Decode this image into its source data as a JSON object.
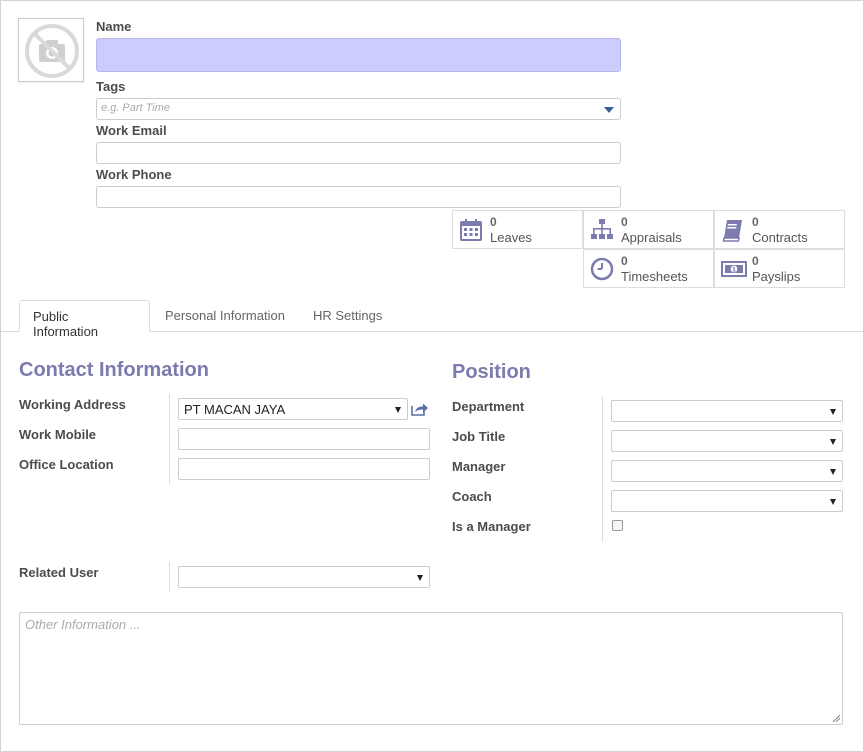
{
  "header": {
    "avatar_icon": "camera-off-icon",
    "name_label": "Name",
    "name_value": "",
    "tags_label": "Tags",
    "tags_placeholder": "e.g. Part Time",
    "email_label": "Work Email",
    "email_value": "",
    "phone_label": "Work Phone",
    "phone_value": ""
  },
  "smart_buttons": [
    {
      "count": "0",
      "label": "Leaves",
      "icon": "calendar-icon"
    },
    {
      "count": "0",
      "label": "Appraisals",
      "icon": "sitemap-icon"
    },
    {
      "count": "0",
      "label": "Contracts",
      "icon": "book-icon"
    },
    {
      "count": "0",
      "label": "Timesheets",
      "icon": "clock-icon"
    },
    {
      "count": "0",
      "label": "Payslips",
      "icon": "money-icon"
    }
  ],
  "tabs": [
    {
      "label": "Public Information",
      "active": true
    },
    {
      "label": "Personal Information",
      "active": false
    },
    {
      "label": "HR Settings",
      "active": false
    }
  ],
  "contact": {
    "title": "Contact Information",
    "working_address_label": "Working Address",
    "working_address_value": "PT MACAN JAYA",
    "work_mobile_label": "Work Mobile",
    "work_mobile_value": "",
    "office_location_label": "Office Location",
    "office_location_value": "",
    "related_user_label": "Related User",
    "related_user_value": ""
  },
  "position": {
    "title": "Position",
    "department_label": "Department",
    "department_value": "",
    "job_title_label": "Job Title",
    "job_title_value": "",
    "manager_label": "Manager",
    "manager_value": "",
    "coach_label": "Coach",
    "coach_value": "",
    "is_manager_label": "Is a Manager",
    "is_manager_checked": false
  },
  "notes": {
    "placeholder": "Other Information ..."
  },
  "colors": {
    "accent": "#7c7bad",
    "name_field_bg": "#ccccff",
    "icon_color": "#7c7bad"
  }
}
